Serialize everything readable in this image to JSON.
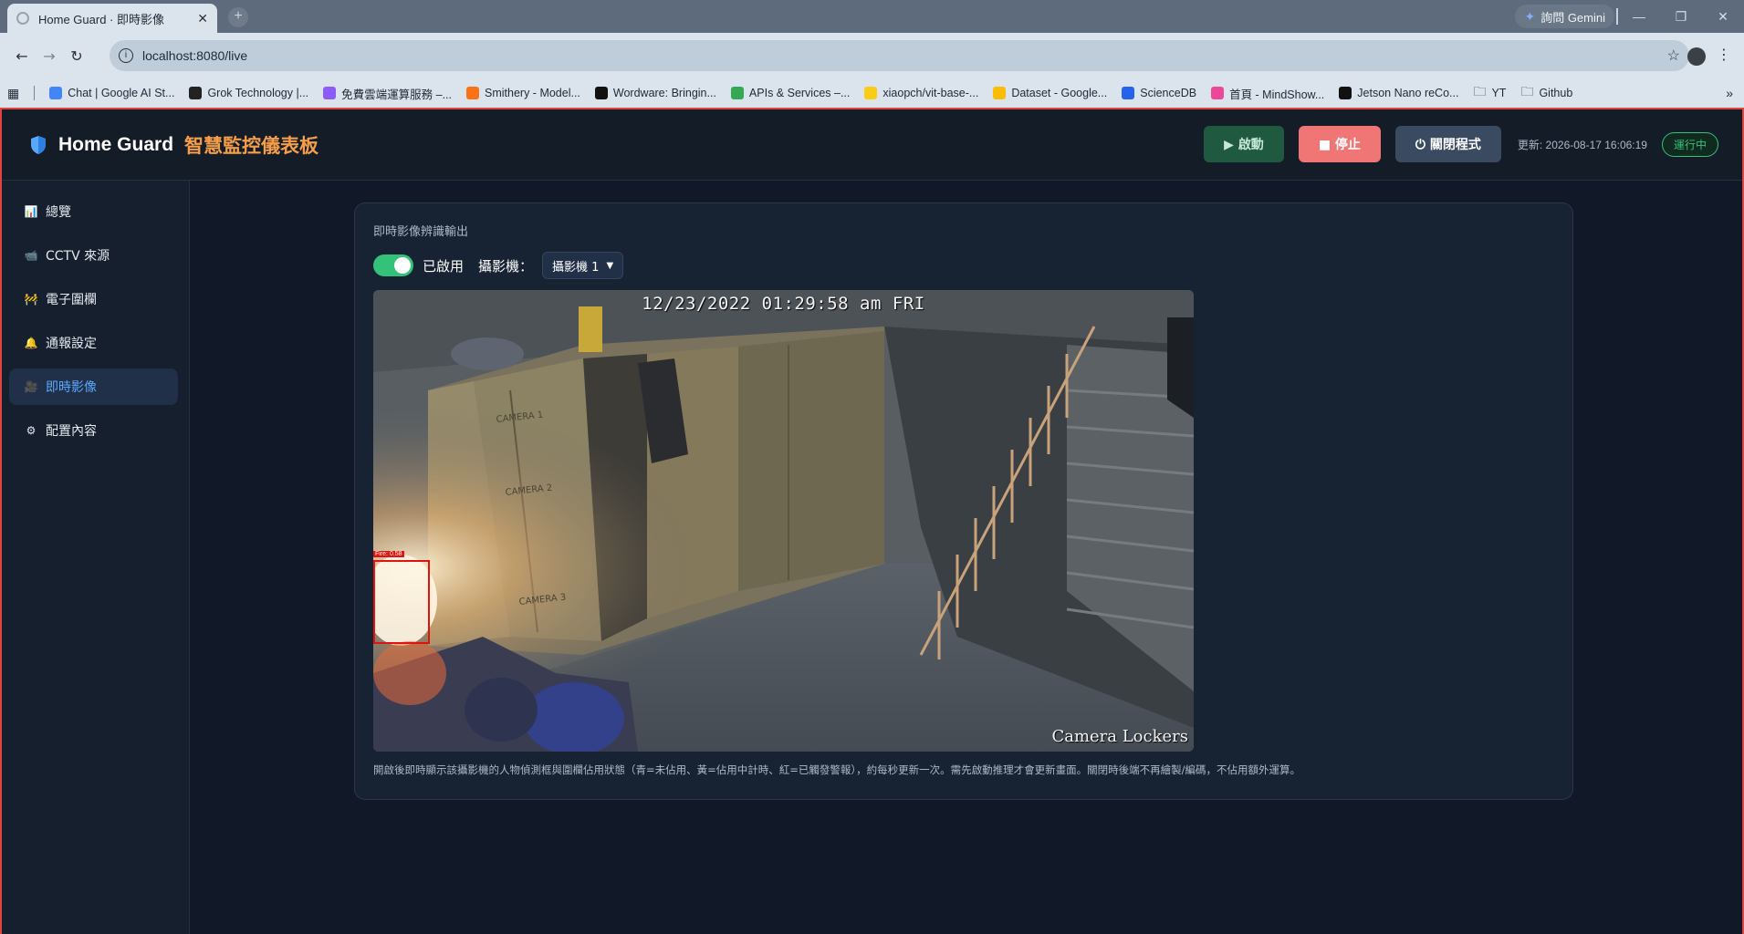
{
  "browser": {
    "tab_title": "Home Guard · 即時影像",
    "new_tab": "+",
    "gemini_label": "詢問 Gemini",
    "url": "localhost:8080/live",
    "bookmarks": [
      {
        "label": "Chat | Google AI St...",
        "color": "#4285f4"
      },
      {
        "label": "Grok Technology |...",
        "color": "#222222"
      },
      {
        "label": "免費雲端運算服務 –...",
        "color": "#8b5cf6"
      },
      {
        "label": "Smithery - Model...",
        "color": "#f97316"
      },
      {
        "label": "Wordware: Bringin...",
        "color": "#111111"
      },
      {
        "label": "APIs & Services –...",
        "color": "#34a853"
      },
      {
        "label": "xiaopch/vit-base-...",
        "color": "#facc15"
      },
      {
        "label": "Dataset - Google...",
        "color": "#fbbc04"
      },
      {
        "label": "ScienceDB",
        "color": "#2563eb"
      },
      {
        "label": "首頁 - MindShow...",
        "color": "#ec4899"
      },
      {
        "label": "Jetson Nano reCo...",
        "color": "#111111"
      },
      {
        "label": "YT",
        "color": "folder"
      },
      {
        "label": "Github",
        "color": "folder"
      }
    ]
  },
  "header": {
    "brand_en": "Home Guard",
    "brand_zh": "智慧監控儀表板",
    "start_label": "▶ 啟動",
    "stop_label": "■ 停止",
    "close_label": "⏻ 關閉程式",
    "updated": "更新: 2026-08-17 16:06:19",
    "status": "運行中"
  },
  "sidebar": {
    "items": [
      {
        "icon": "📊",
        "label": "總覽"
      },
      {
        "icon": "📹",
        "label": "CCTV 來源"
      },
      {
        "icon": "🚧",
        "label": "電子圍欄"
      },
      {
        "icon": "🔔",
        "label": "通報設定"
      },
      {
        "icon": "🎥",
        "label": "即時影像",
        "active": true
      },
      {
        "icon": "⚙",
        "label": "配置內容"
      }
    ]
  },
  "live": {
    "card_title": "即時影像辨識輸出",
    "enabled_label": "已啟用",
    "camera_label": "攝影機：",
    "camera_selected": "攝影機 1",
    "osd_timestamp": "12/23/2022 01:29:58 am FRI",
    "osd_camera_name": "Camera Lockers",
    "detection_label": "Fire: 0.58",
    "locker_labels": [
      "CAMERA 1",
      "CAMERA 2",
      "CAMERA 3"
    ],
    "note": "開啟後即時顯示該攝影機的人物偵測框與圍欄佔用狀態（青=未佔用、黃=佔用中計時、紅=已觸發警報），約每秒更新一次。需先啟動推理才會更新畫面。關閉時後端不再繪製/編碼，不佔用額外運算。"
  },
  "colors": {
    "accent_orange": "#f59e4a",
    "active_blue": "#5aa7ff",
    "status_green": "#34c17a",
    "stop_red": "#f07676",
    "frame_red": "#e0443e"
  }
}
